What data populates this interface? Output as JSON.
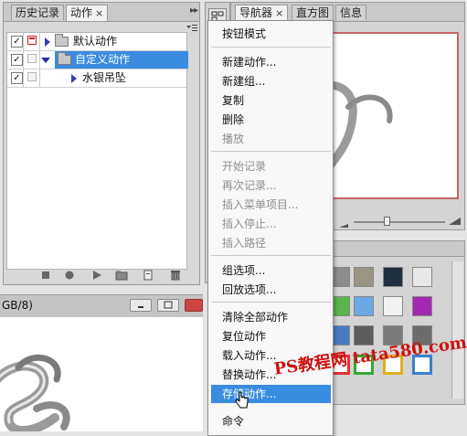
{
  "actions_panel": {
    "tabs": [
      {
        "label": "历史记录"
      },
      {
        "label": "动作",
        "close": "×"
      }
    ],
    "menu_glyph": "▸▸",
    "rows": [
      {
        "label": "默认动作",
        "checked": "✓"
      },
      {
        "label": "自定义动作",
        "checked": "✓"
      },
      {
        "label": "水银吊坠",
        "checked": "✓"
      }
    ]
  },
  "document": {
    "title_fragment": "GB/8)"
  },
  "navigator_panel": {
    "tabs": [
      {
        "label": "导航器",
        "close": "×"
      },
      {
        "label": "直方图"
      },
      {
        "label": "信息"
      }
    ]
  },
  "context_menu": {
    "items": [
      {
        "label": "按钮模式"
      },
      {
        "label": "新建动作..."
      },
      {
        "label": "新建组..."
      },
      {
        "label": "复制"
      },
      {
        "label": "删除"
      },
      {
        "label": "播放"
      },
      {
        "label": "开始记录"
      },
      {
        "label": "再次记录..."
      },
      {
        "label": "插入菜单项目..."
      },
      {
        "label": "插入停止..."
      },
      {
        "label": "插入路径"
      },
      {
        "label": "组选项..."
      },
      {
        "label": "回放选项..."
      },
      {
        "label": "清除全部动作"
      },
      {
        "label": "复位动作"
      },
      {
        "label": "载入动作..."
      },
      {
        "label": "替换动作..."
      },
      {
        "label": "存储动作..."
      },
      {
        "label": "命令"
      }
    ],
    "highlighted": "存储动作..."
  },
  "watermark": "PS教程网 tata580.com",
  "colors": {
    "selection": "#3a8ce0",
    "navigator_frame": "#c86464",
    "watermark": "#cc1111"
  }
}
